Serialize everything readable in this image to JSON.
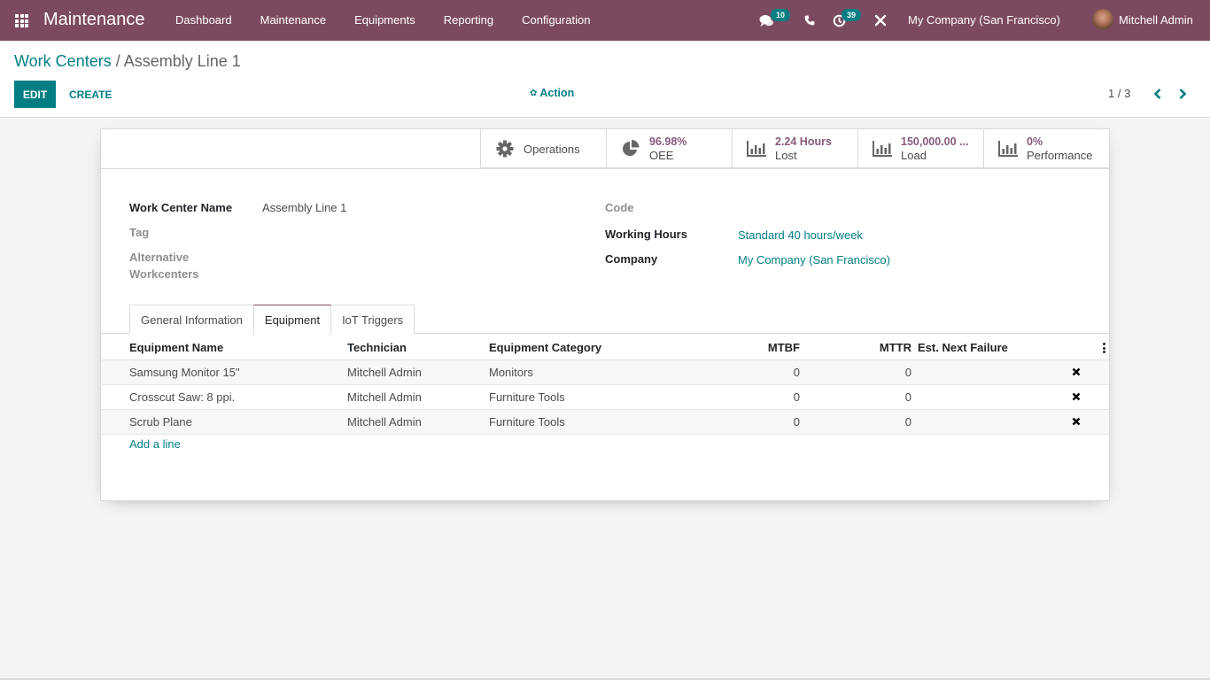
{
  "navbar": {
    "app_title": "Maintenance",
    "menu": [
      "Dashboard",
      "Maintenance",
      "Equipments",
      "Reporting",
      "Configuration"
    ],
    "messages_badge": "10",
    "activities_badge": "39",
    "company": "My Company (San Francisco)",
    "user": "Mitchell Admin",
    "accent_color": "#7c4a60"
  },
  "control_panel": {
    "breadcrumb_parent": "Work Centers",
    "breadcrumb_separator": "/",
    "breadcrumb_current": "Assembly Line 1",
    "edit_label": "EDIT",
    "create_label": "CREATE",
    "action_label": "Action",
    "pager": "1 / 3"
  },
  "stat_buttons": {
    "operations": {
      "label": "Operations"
    },
    "oee": {
      "value": "96.98%",
      "label": "OEE"
    },
    "lost": {
      "value": "2.24 Hours",
      "label": "Lost"
    },
    "load": {
      "value": "150,000.00 ...",
      "label": "Load"
    },
    "performance": {
      "value": "0%",
      "label": "Performance"
    }
  },
  "form": {
    "name_label": "Work Center Name",
    "name_value": "Assembly Line 1",
    "tag_label": "Tag",
    "alt_label_1": "Alternative",
    "alt_label_2": "Workcenters",
    "code_label": "Code",
    "working_hours_label": "Working Hours",
    "working_hours_value": "Standard 40 hours/week",
    "company_label": "Company",
    "company_value": "My Company (San Francisco)"
  },
  "tabs": [
    "General Information",
    "Equipment",
    "IoT Triggers"
  ],
  "active_tab": "Equipment",
  "equipment_table": {
    "columns": [
      "Equipment Name",
      "Technician",
      "Equipment Category",
      "MTBF",
      "MTTR",
      "Est. Next Failure"
    ],
    "rows": [
      {
        "name": "Samsung Monitor 15\"",
        "technician": "Mitchell Admin",
        "category": "Monitors",
        "mtbf": "0",
        "mttr": "0",
        "next_failure": ""
      },
      {
        "name": "Crosscut Saw: 8 ppi.",
        "technician": "Mitchell Admin",
        "category": "Furniture Tools",
        "mtbf": "0",
        "mttr": "0",
        "next_failure": ""
      },
      {
        "name": "Scrub Plane",
        "technician": "Mitchell Admin",
        "category": "Furniture Tools",
        "mtbf": "0",
        "mttr": "0",
        "next_failure": ""
      }
    ],
    "add_line_label": "Add a line"
  }
}
